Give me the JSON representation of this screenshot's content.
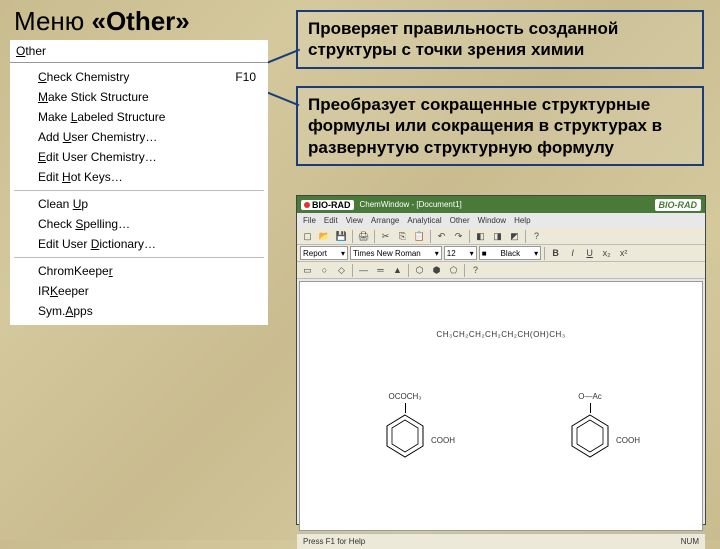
{
  "slide": {
    "title_prefix": "Меню ",
    "title_main": "«Other»"
  },
  "menu": {
    "header": "Other",
    "items": [
      {
        "label_pre": "",
        "label_u": "C",
        "label_post": "heck Chemistry",
        "shortcut": "F10"
      },
      {
        "label_pre": "",
        "label_u": "M",
        "label_post": "ake Stick Structure",
        "shortcut": ""
      },
      {
        "label_pre": "Make ",
        "label_u": "L",
        "label_post": "abeled Structure",
        "shortcut": ""
      },
      {
        "label_pre": "Add ",
        "label_u": "U",
        "label_post": "ser Chemistry…",
        "shortcut": ""
      },
      {
        "label_pre": "",
        "label_u": "E",
        "label_post": "dit User Chemistry…",
        "shortcut": ""
      },
      {
        "label_pre": "Edit ",
        "label_u": "H",
        "label_post": "ot Keys…",
        "shortcut": ""
      }
    ],
    "group2": [
      {
        "label_pre": "Clean ",
        "label_u": "U",
        "label_post": "p",
        "shortcut": ""
      },
      {
        "label_pre": "Check ",
        "label_u": "S",
        "label_post": "pelling…",
        "shortcut": ""
      },
      {
        "label_pre": "Edit User ",
        "label_u": "D",
        "label_post": "ictionary…",
        "shortcut": ""
      }
    ],
    "group3": [
      {
        "label_pre": "ChromKeepe",
        "label_u": "r",
        "label_post": "",
        "shortcut": ""
      },
      {
        "label_pre": "IR",
        "label_u": "K",
        "label_post": "eeper",
        "shortcut": ""
      },
      {
        "label_pre": "Sym.",
        "label_u": "A",
        "label_post": "pps",
        "shortcut": ""
      }
    ]
  },
  "callouts": {
    "c1": "Проверяет правильность созданной структуры с точки зрения химии",
    "c2": "Преобразует сокращенные структурные формулы или сокращения в структурах в развернутую структурную формулу"
  },
  "app": {
    "brand": "BIO-RAD",
    "title": "ChemWindow - [Document1]",
    "brand_right": "BIO-RAD",
    "menus": [
      "File",
      "Edit",
      "View",
      "Arrange",
      "Analytical",
      "Other",
      "Window",
      "Help"
    ],
    "font_family": "Report",
    "font_name": "Times New Roman",
    "font_size": "12",
    "color": "Black",
    "chem_text": "CH₃CH₂CH₂CH₂CH₂CH(OH)CH₃",
    "left_top": "OCOCH₃",
    "left_side": "COOH",
    "right_top": "O—Ac",
    "right_side": "COOH",
    "status_left": "Press F1 for Help",
    "status_right": "NUM"
  }
}
